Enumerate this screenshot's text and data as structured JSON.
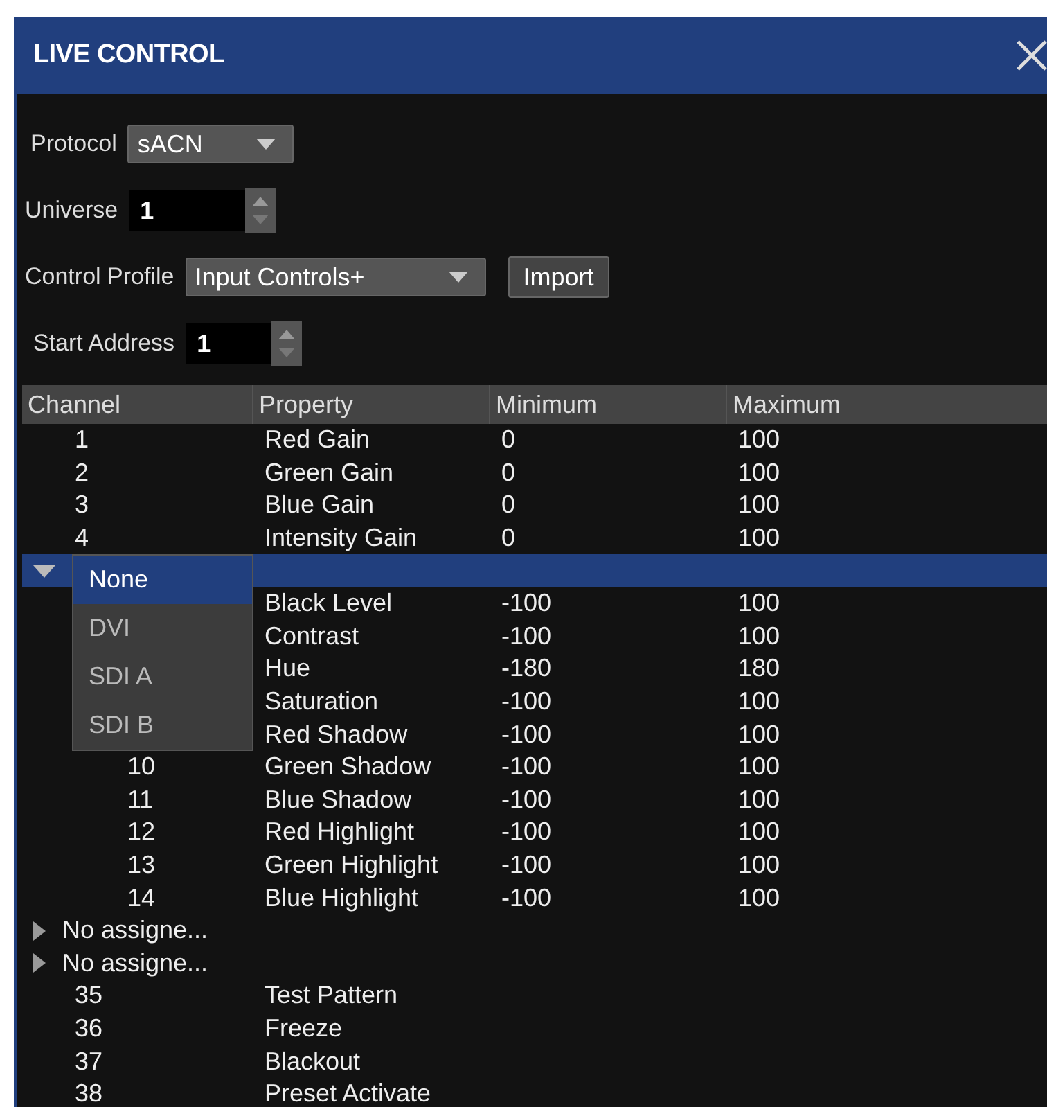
{
  "window": {
    "title": "LIVE CONTROL"
  },
  "form": {
    "protocol": {
      "label": "Protocol",
      "value": "sACN"
    },
    "universe": {
      "label": "Universe",
      "value": "1"
    },
    "control_profile": {
      "label": "Control Profile",
      "value": "Input Controls+"
    },
    "import_button": "Import",
    "start_address": {
      "label": "Start Address",
      "value": "1"
    }
  },
  "table": {
    "columns": [
      "Channel",
      "Property",
      "Minimum",
      "Maximum"
    ],
    "rows": [
      {
        "kind": "row",
        "channel": "1",
        "property": "Red Gain",
        "minimum": "0",
        "maximum": "100"
      },
      {
        "kind": "row",
        "channel": "2",
        "property": "Green Gain",
        "minimum": "0",
        "maximum": "100"
      },
      {
        "kind": "row",
        "channel": "3",
        "property": "Blue Gain",
        "minimum": "0",
        "maximum": "100"
      },
      {
        "kind": "row",
        "channel": "4",
        "property": "Intensity Gain",
        "minimum": "0",
        "maximum": "100"
      },
      {
        "kind": "group",
        "expanded": true,
        "selected": true,
        "dropdown": {
          "options": [
            {
              "label": "None",
              "selected": true
            },
            {
              "label": "DVI",
              "selected": false
            },
            {
              "label": "SDI A",
              "selected": false
            },
            {
              "label": "SDI B",
              "selected": false
            }
          ]
        },
        "children": [
          {
            "kind": "row",
            "property": "Black Level",
            "minimum": "-100",
            "maximum": "100"
          },
          {
            "kind": "row",
            "property": "Contrast",
            "minimum": "-100",
            "maximum": "100"
          },
          {
            "kind": "row",
            "property": "Hue",
            "minimum": "-180",
            "maximum": "180"
          },
          {
            "kind": "row",
            "property": "Saturation",
            "minimum": "-100",
            "maximum": "100"
          },
          {
            "kind": "row",
            "property": "Red Shadow",
            "minimum": "-100",
            "maximum": "100"
          },
          {
            "kind": "row",
            "channel": "10",
            "property": "Green Shadow",
            "minimum": "-100",
            "maximum": "100"
          },
          {
            "kind": "row",
            "channel": "11",
            "property": "Blue Shadow",
            "minimum": "-100",
            "maximum": "100"
          },
          {
            "kind": "row",
            "channel": "12",
            "property": "Red Highlight",
            "minimum": "-100",
            "maximum": "100"
          },
          {
            "kind": "row",
            "channel": "13",
            "property": "Green Highlight",
            "minimum": "-100",
            "maximum": "100"
          },
          {
            "kind": "row",
            "channel": "14",
            "property": "Blue Highlight",
            "minimum": "-100",
            "maximum": "100"
          }
        ]
      },
      {
        "kind": "group",
        "label": "No assigne...",
        "expanded": false,
        "selected": false
      },
      {
        "kind": "group",
        "label": "No assigne...",
        "expanded": false,
        "selected": false
      },
      {
        "kind": "row",
        "channel": "35",
        "property": "Test Pattern"
      },
      {
        "kind": "row",
        "channel": "36",
        "property": "Freeze"
      },
      {
        "kind": "row",
        "channel": "37",
        "property": "Blackout"
      },
      {
        "kind": "row",
        "channel": "38",
        "property": "Preset Activate"
      }
    ]
  }
}
